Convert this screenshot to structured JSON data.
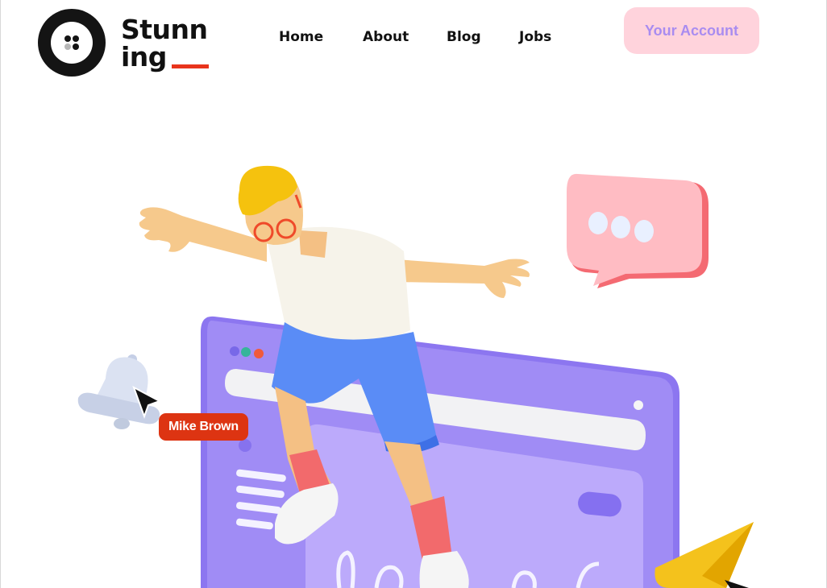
{
  "logo": {
    "line1": "Stunn",
    "line2": "ing"
  },
  "nav": {
    "items": [
      {
        "label": "Home"
      },
      {
        "label": "About"
      },
      {
        "label": "Blog"
      },
      {
        "label": "Jobs"
      }
    ]
  },
  "account_button": {
    "label": "Your Account"
  },
  "hero": {
    "badge_name": "Mike Brown"
  },
  "colors": {
    "accent_red": "#e8341c",
    "button_bg": "#ffd3dc",
    "button_text": "#a98cf0",
    "browser_purple": "#a08cf5"
  }
}
